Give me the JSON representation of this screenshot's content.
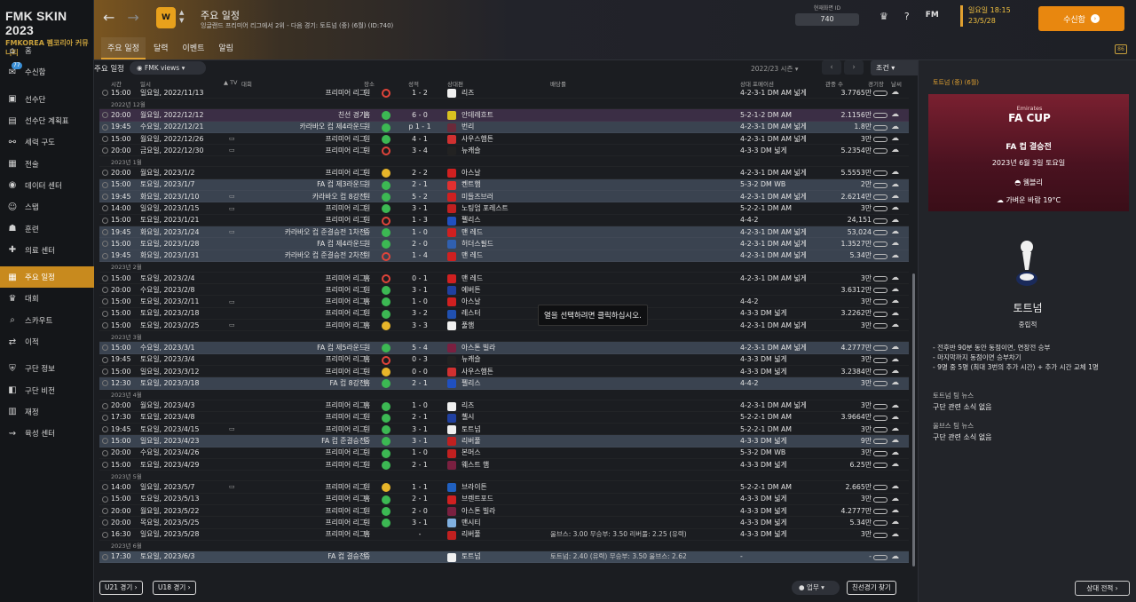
{
  "brand": {
    "title": "FMK SKIN 2023",
    "sub": "FMKOREA 펨코리아 커뮤니티"
  },
  "sidebar": [
    {
      "label": "홈",
      "icon": "home-icon",
      "glyph": "⌂"
    },
    {
      "label": "수신함",
      "icon": "inbox-icon",
      "glyph": "✉",
      "badge": "77"
    },
    {
      "label": "선수단",
      "icon": "shirt-icon",
      "glyph": "▣"
    },
    {
      "label": "선수단 계획표",
      "icon": "clipboard-icon",
      "glyph": "▤"
    },
    {
      "label": "세력 구도",
      "icon": "hierarchy-icon",
      "glyph": "⚯"
    },
    {
      "label": "전술",
      "icon": "tactics-icon",
      "glyph": "▦"
    },
    {
      "label": "데이터 센터",
      "icon": "data-hub-icon",
      "glyph": "◉"
    },
    {
      "label": "스탭",
      "icon": "staff-icon",
      "glyph": "☺"
    },
    {
      "label": "훈련",
      "icon": "training-icon",
      "glyph": "☗"
    },
    {
      "label": "의료 센터",
      "icon": "medical-icon",
      "glyph": "✚"
    },
    {
      "label": "주요 일정",
      "icon": "schedule-icon",
      "glyph": "▦",
      "active": true
    },
    {
      "label": "대회",
      "icon": "trophy-icon",
      "glyph": "♛"
    },
    {
      "label": "스카우트",
      "icon": "scouting-icon",
      "glyph": "⌕"
    },
    {
      "label": "이적",
      "icon": "transfers-icon",
      "glyph": "⇄"
    },
    {
      "label": "구단 정보",
      "icon": "club-info-icon",
      "glyph": "⛨"
    },
    {
      "label": "구단 비전",
      "icon": "club-vision-icon",
      "glyph": "◧"
    },
    {
      "label": "재정",
      "icon": "finances-icon",
      "glyph": "▥"
    },
    {
      "label": "육성 센터",
      "icon": "development-icon",
      "glyph": "⇝"
    }
  ],
  "topbar": {
    "title": "주요 일정",
    "subtitle": "잉글랜드 프리미어 리그에서 2위 - 다음 경기: 토트넘 (중) (6월) (ID:740)",
    "tabs": [
      "주요 일정",
      "달력",
      "이벤트",
      "알림"
    ],
    "id_label": "현재화면 ID",
    "id_value": "740",
    "fm_label": "FM",
    "date_line1": "일요일 18:15",
    "date_line2": "23/5/28",
    "continue_label": "수신함",
    "corner": "86"
  },
  "filters": {
    "title": "주요 일정",
    "views": "FMK views",
    "season": "2022/23 시즌",
    "conditions": "조건"
  },
  "headers": [
    "시간",
    "일시",
    "▲ TV",
    "대회",
    "장소",
    "성적",
    "상대편",
    "배당률",
    "상대 포메이션",
    "관중 수",
    "경기장",
    "날씨"
  ],
  "fixtures": [
    {
      "time": "15:00",
      "date": "일요일, 2022/11/13",
      "tv": "",
      "comp": "프리미어 리그",
      "venue": "원",
      "res": "loss",
      "score": "1 - 2",
      "crest": "#f0f0f0",
      "opp": "리즈",
      "odds": "",
      "form": "4-2-3-1 DM AM 넓게",
      "att": "3.7765만",
      "bg": ""
    },
    {
      "month": "2022년 12월"
    },
    {
      "time": "20:00",
      "date": "월요일, 2022/12/12",
      "tv": "",
      "comp": "친선 경기",
      "venue": "홈",
      "res": "win",
      "score": "6 - 0",
      "crest": "#d8c020",
      "opp": "안데레흐트",
      "odds": "",
      "form": "5-2-1-2 DM AM",
      "att": "2.1156만",
      "bg": "purple"
    },
    {
      "time": "19:45",
      "date": "수요일, 2022/12/21",
      "tv": "",
      "comp": "카라바오 컵 제4라운드",
      "venue": "원",
      "res": "win",
      "score": "p 1 - 1",
      "crest": "#6a2a3a",
      "opp": "번리",
      "odds": "",
      "form": "4-2-3-1 DM AM 넓게",
      "att": "1.8만",
      "bg": "alt"
    },
    {
      "time": "15:00",
      "date": "월요일, 2022/12/26",
      "tv": "tv",
      "comp": "프리미어 리그",
      "venue": "원",
      "res": "win",
      "score": "4 - 1",
      "crest": "#d03030",
      "opp": "사우스햄튼",
      "odds": "",
      "form": "4-2-3-1 DM AM 넓게",
      "att": "3만",
      "bg": ""
    },
    {
      "time": "20:00",
      "date": "금요일, 2022/12/30",
      "tv": "tv",
      "comp": "프리미어 리그",
      "venue": "원",
      "res": "loss",
      "score": "3 - 4",
      "crest": "#222222",
      "opp": "뉴캐슬",
      "odds": "",
      "form": "4-3-3 DM 넓게",
      "att": "5.2354만",
      "bg": ""
    },
    {
      "month": "2023년 1월"
    },
    {
      "time": "20:00",
      "date": "월요일, 2023/1/2",
      "tv": "",
      "comp": "프리미어 리그",
      "venue": "원",
      "res": "draw",
      "score": "2 - 2",
      "crest": "#d02020",
      "opp": "아스날",
      "odds": "",
      "form": "4-2-3-1 DM AM 넓게",
      "att": "5.5553만",
      "bg": ""
    },
    {
      "time": "15:00",
      "date": "토요일, 2023/1/7",
      "tv": "",
      "comp": "FA 컵 제3라운드",
      "venue": "원",
      "res": "win",
      "score": "2 - 1",
      "crest": "#e03030",
      "opp": "켄트햄",
      "odds": "",
      "form": "5-3-2 DM WB",
      "att": "2만",
      "bg": "alt"
    },
    {
      "time": "19:45",
      "date": "화요일, 2023/1/10",
      "tv": "tv",
      "comp": "카라바오 컵 8강전",
      "venue": "원",
      "res": "win",
      "score": "5 - 2",
      "crest": "#d02020",
      "opp": "미들즈브러",
      "odds": "",
      "form": "4-2-3-1 DM AM 넓게",
      "att": "2.6214만",
      "bg": "alt"
    },
    {
      "time": "14:00",
      "date": "일요일, 2023/1/15",
      "tv": "tv",
      "comp": "프리미어 리그",
      "venue": "원",
      "res": "win",
      "score": "3 - 1",
      "crest": "#c02020",
      "opp": "노팅엄 포레스트",
      "odds": "",
      "form": "5-2-2-1 DM AM",
      "att": "3만",
      "bg": ""
    },
    {
      "time": "15:00",
      "date": "토요일, 2023/1/21",
      "tv": "",
      "comp": "프리미어 리그",
      "venue": "원",
      "res": "loss",
      "score": "1 - 3",
      "crest": "#2050c0",
      "opp": "펠리스",
      "odds": "",
      "form": "4-4-2",
      "att": "24,151",
      "bg": ""
    },
    {
      "time": "19:45",
      "date": "화요일, 2023/1/24",
      "tv": "tv",
      "comp": "카라바오 컵 준결승전 1차전",
      "venue": "중",
      "res": "win",
      "score": "1 - 0",
      "crest": "#d02020",
      "opp": "맨 레드",
      "odds": "",
      "form": "4-2-3-1 DM AM 넓게",
      "att": "53,024",
      "bg": "alt"
    },
    {
      "time": "15:00",
      "date": "토요일, 2023/1/28",
      "tv": "",
      "comp": "FA 컵 제4라운드",
      "venue": "원",
      "res": "win",
      "score": "2 - 0",
      "crest": "#3060b0",
      "opp": "허더스필드",
      "odds": "",
      "form": "4-2-3-1 DM AM 넓게",
      "att": "1.3527만",
      "bg": "alt"
    },
    {
      "time": "19:45",
      "date": "화요일, 2023/1/31",
      "tv": "",
      "comp": "카라바오 컵 준결승전 2차전",
      "venue": "원",
      "res": "loss",
      "score": "1 - 4",
      "crest": "#d02020",
      "opp": "맨 레드",
      "odds": "",
      "form": "4-2-3-1 DM AM 넓게",
      "att": "5.34만",
      "bg": "alt"
    },
    {
      "month": "2023년 2월"
    },
    {
      "time": "15:00",
      "date": "토요일, 2023/2/4",
      "tv": "",
      "comp": "프리미어 리그",
      "venue": "홈",
      "res": "loss",
      "score": "0 - 1",
      "crest": "#d02020",
      "opp": "맨 레드",
      "odds": "",
      "form": "4-2-3-1 DM AM 넓게",
      "att": "3만",
      "bg": ""
    },
    {
      "time": "20:00",
      "date": "수요일, 2023/2/8",
      "tv": "",
      "comp": "프리미어 리그",
      "venue": "원",
      "res": "win",
      "score": "3 - 1",
      "crest": "#2040a0",
      "opp": "에버튼",
      "odds": "",
      "form": "",
      "att": "3.6312만",
      "bg": ""
    },
    {
      "time": "15:00",
      "date": "토요일, 2023/2/11",
      "tv": "tv",
      "comp": "프리미어 리그",
      "venue": "홈",
      "res": "win",
      "score": "1 - 0",
      "crest": "#d02020",
      "opp": "아스날",
      "odds": "",
      "form": "4-4-2",
      "att": "3만",
      "bg": ""
    },
    {
      "time": "15:00",
      "date": "토요일, 2023/2/18",
      "tv": "",
      "comp": "프리미어 리그",
      "venue": "원",
      "res": "win",
      "score": "3 - 2",
      "crest": "#2050b0",
      "opp": "레스터",
      "odds": "",
      "form": "4-3-3 DM 넓게",
      "att": "3.2262만",
      "bg": ""
    },
    {
      "time": "15:00",
      "date": "토요일, 2023/2/25",
      "tv": "tv",
      "comp": "프리미어 리그",
      "venue": "홈",
      "res": "draw",
      "score": "3 - 3",
      "crest": "#f0f0f0",
      "opp": "풀햄",
      "odds": "",
      "form": "4-2-3-1 DM AM 넓게",
      "att": "3만",
      "bg": ""
    },
    {
      "month": "2023년 3월"
    },
    {
      "time": "15:00",
      "date": "수요일, 2023/3/1",
      "tv": "",
      "comp": "FA 컵 제5라운드",
      "venue": "원",
      "res": "win",
      "score": "5 - 4",
      "crest": "#7a2040",
      "opp": "아스톤 빌라",
      "odds": "",
      "form": "4-2-3-1 DM AM 넓게",
      "att": "4.2777만",
      "bg": "alt"
    },
    {
      "time": "19:45",
      "date": "토요일, 2023/3/4",
      "tv": "",
      "comp": "프리미어 리그",
      "venue": "홈",
      "res": "loss",
      "score": "0 - 3",
      "crest": "#222222",
      "opp": "뉴캐슬",
      "odds": "",
      "form": "4-3-3 DM 넓게",
      "att": "3만",
      "bg": ""
    },
    {
      "time": "15:00",
      "date": "일요일, 2023/3/12",
      "tv": "",
      "comp": "프리미어 리그",
      "venue": "원",
      "res": "draw",
      "score": "0 - 0",
      "crest": "#d03030",
      "opp": "사우스햄튼",
      "odds": "",
      "form": "4-3-3 DM 넓게",
      "att": "3.2384만",
      "bg": ""
    },
    {
      "time": "12:30",
      "date": "토요일, 2023/3/18",
      "tv": "",
      "comp": "FA 컵 8강전",
      "venue": "홈",
      "res": "win",
      "score": "2 - 1",
      "crest": "#2050c0",
      "opp": "펠리스",
      "odds": "",
      "form": "4-4-2",
      "att": "3만",
      "bg": "alt"
    },
    {
      "month": "2023년 4월"
    },
    {
      "time": "20:00",
      "date": "월요일, 2023/4/3",
      "tv": "",
      "comp": "프리미어 리그",
      "venue": "홈",
      "res": "win",
      "score": "1 - 0",
      "crest": "#f0f0f0",
      "opp": "리즈",
      "odds": "",
      "form": "4-2-3-1 DM AM 넓게",
      "att": "3만",
      "bg": ""
    },
    {
      "time": "17:30",
      "date": "토요일, 2023/4/8",
      "tv": "",
      "comp": "프리미어 리그",
      "venue": "원",
      "res": "win",
      "score": "2 - 1",
      "crest": "#2040a0",
      "opp": "첼시",
      "odds": "",
      "form": "5-2-2-1 DM AM",
      "att": "3.9664만",
      "bg": ""
    },
    {
      "time": "19:45",
      "date": "토요일, 2023/4/15",
      "tv": "tv",
      "comp": "프리미어 리그",
      "venue": "원",
      "res": "win",
      "score": "3 - 1",
      "crest": "#f0f0f0",
      "opp": "토트넘",
      "odds": "",
      "form": "5-2-2-1 DM AM",
      "att": "3만",
      "bg": ""
    },
    {
      "time": "15:00",
      "date": "일요일, 2023/4/23",
      "tv": "",
      "comp": "FA 컵 준결승전",
      "venue": "중",
      "res": "win",
      "score": "3 - 1",
      "crest": "#c02020",
      "opp": "리버풀",
      "odds": "",
      "form": "4-3-3 DM 넓게",
      "att": "9만",
      "bg": "alt"
    },
    {
      "time": "20:00",
      "date": "수요일, 2023/4/26",
      "tv": "",
      "comp": "프리미어 리그",
      "venue": "원",
      "res": "win",
      "score": "1 - 0",
      "crest": "#c02020",
      "opp": "본머스",
      "odds": "",
      "form": "5-3-2 DM WB",
      "att": "3만",
      "bg": ""
    },
    {
      "time": "15:00",
      "date": "토요일, 2023/4/29",
      "tv": "",
      "comp": "프리미어 리그",
      "venue": "원",
      "res": "win",
      "score": "2 - 1",
      "crest": "#7a2040",
      "opp": "웨스트 햄",
      "odds": "",
      "form": "4-3-3 DM 넓게",
      "att": "6.25만",
      "bg": ""
    },
    {
      "month": "2023년 5월"
    },
    {
      "time": "14:00",
      "date": "일요일, 2023/5/7",
      "tv": "tv",
      "comp": "프리미어 리그",
      "venue": "원",
      "res": "draw",
      "score": "1 - 1",
      "crest": "#2060c0",
      "opp": "브라이튼",
      "odds": "",
      "form": "5-2-2-1 DM AM",
      "att": "2.665만",
      "bg": ""
    },
    {
      "time": "15:00",
      "date": "토요일, 2023/5/13",
      "tv": "",
      "comp": "프리미어 리그",
      "venue": "홈",
      "res": "win",
      "score": "2 - 1",
      "crest": "#d02020",
      "opp": "브렌트포드",
      "odds": "",
      "form": "4-3-3 DM 넓게",
      "att": "3만",
      "bg": ""
    },
    {
      "time": "20:00",
      "date": "월요일, 2023/5/22",
      "tv": "",
      "comp": "프리미어 리그",
      "venue": "원",
      "res": "win",
      "score": "2 - 0",
      "crest": "#7a2040",
      "opp": "아스톤 빌라",
      "odds": "",
      "form": "4-3-3 DM 넓게",
      "att": "4.2777만",
      "bg": ""
    },
    {
      "time": "20:00",
      "date": "목요일, 2023/5/25",
      "tv": "",
      "comp": "프리미어 리그",
      "venue": "원",
      "res": "win",
      "score": "3 - 1",
      "crest": "#80b0e0",
      "opp": "맨시티",
      "odds": "",
      "form": "4-3-3 DM 넓게",
      "att": "5.34만",
      "bg": ""
    },
    {
      "time": "16:30",
      "date": "일요일, 2023/5/28",
      "tv": "",
      "comp": "프리미어 리그",
      "venue": "홈",
      "res": "none",
      "score": "-",
      "crest": "#c02020",
      "opp": "리버풀",
      "odds": "울브스: 3.00  무승부: 3.50  리버풀: 2.25 (유력)",
      "form": "4-3-3 DM 넓게",
      "att": "3만",
      "bg": ""
    },
    {
      "month": "2023년 6월"
    },
    {
      "time": "17:30",
      "date": "토요일, 2023/6/3",
      "tv": "",
      "comp": "FA 컵 결승전",
      "venue": "중",
      "res": "none",
      "score": "",
      "crest": "#f0f0f0",
      "opp": "토트넘",
      "odds": "토트넘: 2.40 (유력)  무승부: 3.50  울브스: 2.62",
      "form": "-",
      "att": "-",
      "bg": "next"
    }
  ],
  "tooltip": "열을 선택하려면 클릭하십시오.",
  "bottom": {
    "u21": "U21 경기",
    "u18": "U18 경기",
    "job": "업무",
    "find_friendly": "친선경기 찾기"
  },
  "panel": {
    "header": "토트넘 (중) (6월)",
    "logo_top": "Emirates",
    "logo_main": "FA CUP",
    "comp": "FA 컵 결승전",
    "date": "2023년 6월 3일 토요일",
    "stadium": "웸블리",
    "weather": "가벼운 바람 19°C",
    "team": "토트넘",
    "stance": "중립적",
    "rules": [
      "- 전후반 90분 동안 동점이면, 연장전 승부",
      "- 마지막까지 동점이면 승부차기",
      "- 9명 중 5명 (최대 3번의 추가 시간) + 추가 시간 교체 1명"
    ],
    "team_news_title": "토트넘 팀 뉴스",
    "team_news": "구단 관련 소식 없음",
    "wolves_news_title": "울브스 팀 뉴스",
    "wolves_news": "구단 관련 소식 없음",
    "h2h": "상대 전적"
  },
  "colors": {
    "accent": "#e8870f",
    "win": "#3cb853",
    "draw": "#e8b62a",
    "loss": "#e0443a"
  }
}
